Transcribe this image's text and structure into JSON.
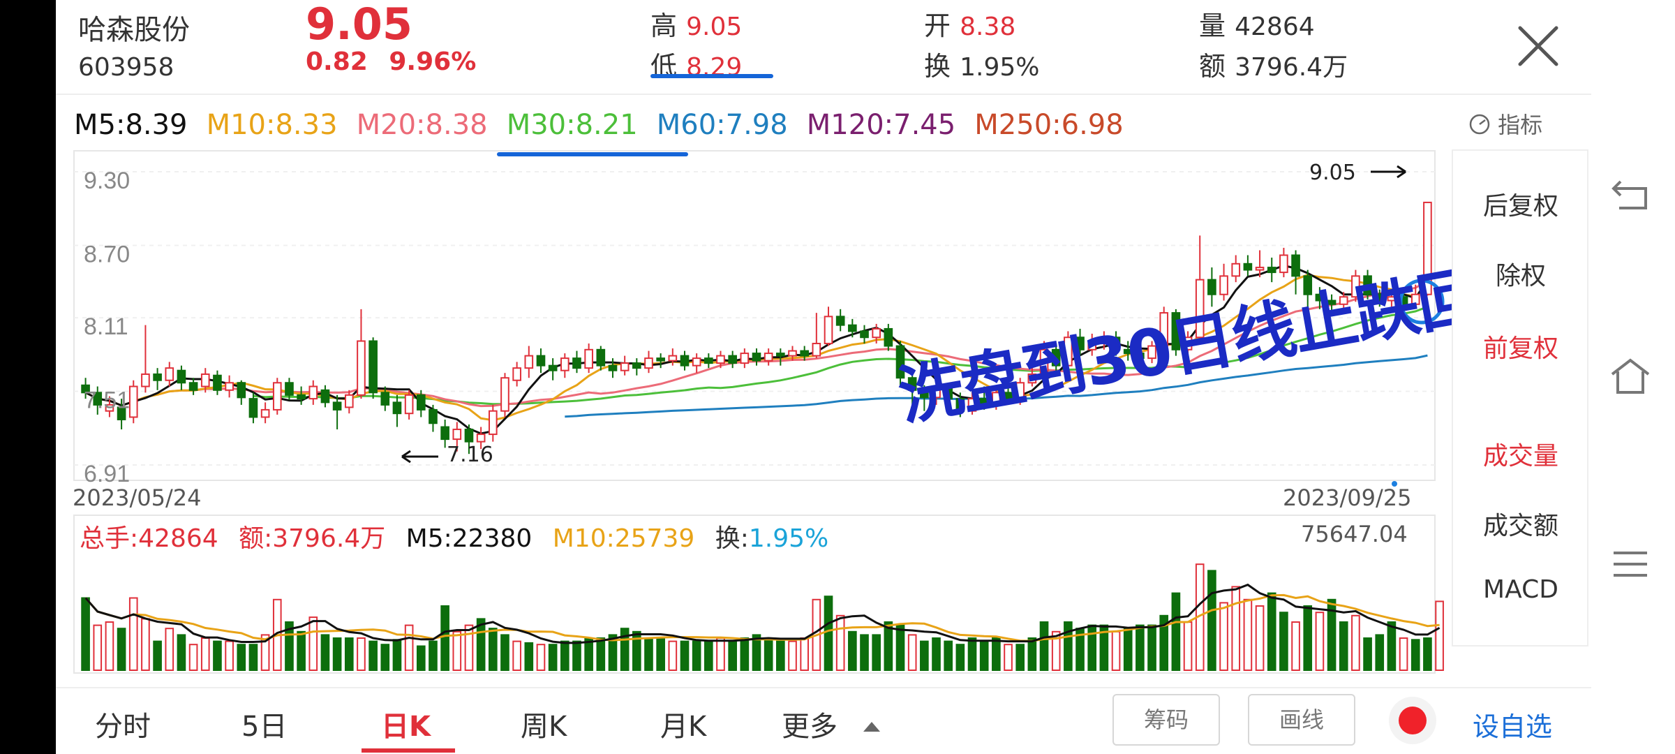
{
  "header": {
    "name": "哈森股份",
    "code": "603958",
    "price": "9.05",
    "change": "0.82",
    "change_pct": "9.96%",
    "high_label": "高",
    "high": "9.05",
    "low_label": "低",
    "low": "8.29",
    "open_label": "开",
    "open": "8.38",
    "turnover_label": "换",
    "turnover": "1.95%",
    "volume_label": "量",
    "volume": "42864",
    "amount_label": "额",
    "amount": "3796.4万"
  },
  "ma": {
    "m5": "M5:8.39",
    "m10": "M10:8.33",
    "m20": "M20:8.38",
    "m30": "M30:8.21",
    "m60": "M60:7.98",
    "m120": "M120:7.45",
    "m250": "M250:6.98"
  },
  "indicator_label": "指标",
  "chart": {
    "price_ticks": [
      "9.30",
      "8.70",
      "8.11",
      "7.51",
      "6.91"
    ],
    "price_ticks_num": [
      9.3,
      8.7,
      8.11,
      7.51,
      6.91
    ],
    "date_start": "2023/05/24",
    "date_end": "2023/09/25",
    "low_annotation": "7.16",
    "high_annotation": "9.05",
    "note": "洗盘到30日线止跌回升",
    "colors": {
      "up": "#e0303a",
      "down": "#0d6e0d",
      "m5": "#111111",
      "m10": "#e8a317",
      "m20": "#ec6b78",
      "m30": "#4cbf3a",
      "m60": "#1f7fbf"
    }
  },
  "volume": {
    "total_label": "总手:42864",
    "amount_label": "额:3796.4万",
    "m5": "M5:22380",
    "m10": "M10:25739",
    "turnover_prefix": "换:",
    "turnover_value": "1.95%",
    "max": "75647.04"
  },
  "sidebar": [
    "后复权",
    "除权",
    "前复权",
    "成交量",
    "成交额",
    "MACD"
  ],
  "tabs": [
    "分时",
    "5日",
    "日K",
    "周K",
    "月K",
    "更多"
  ],
  "buttons": {
    "chips": "筹码",
    "draw": "画线",
    "watchlist": "设自选"
  },
  "chart_data": {
    "type": "candlestick",
    "title": "",
    "x": [
      "2023/05/24",
      "2023/09/25"
    ],
    "ylim": [
      6.91,
      9.3
    ],
    "y_ticks": [
      9.3,
      8.7,
      8.11,
      7.51,
      6.91
    ],
    "candles": [
      [
        7.56,
        7.5,
        7.62,
        7.45
      ],
      [
        7.5,
        7.4,
        7.55,
        7.32
      ],
      [
        7.35,
        7.4,
        7.47,
        7.3
      ],
      [
        7.38,
        7.28,
        7.45,
        7.2
      ],
      [
        7.3,
        7.55,
        7.6,
        7.25
      ],
      [
        7.55,
        7.65,
        8.05,
        7.5
      ],
      [
        7.65,
        7.6,
        7.7,
        7.52
      ],
      [
        7.6,
        7.7,
        7.75,
        7.55
      ],
      [
        7.68,
        7.58,
        7.72,
        7.52
      ],
      [
        7.58,
        7.52,
        7.62,
        7.48
      ],
      [
        7.55,
        7.65,
        7.7,
        7.5
      ],
      [
        7.64,
        7.52,
        7.68,
        7.48
      ],
      [
        7.52,
        7.58,
        7.64,
        7.46
      ],
      [
        7.58,
        7.46,
        7.6,
        7.4
      ],
      [
        7.45,
        7.3,
        7.5,
        7.25
      ],
      [
        7.3,
        7.36,
        7.42,
        7.25
      ],
      [
        7.36,
        7.58,
        7.62,
        7.32
      ],
      [
        7.58,
        7.48,
        7.62,
        7.44
      ],
      [
        7.48,
        7.45,
        7.55,
        7.4
      ],
      [
        7.45,
        7.55,
        7.6,
        7.4
      ],
      [
        7.52,
        7.42,
        7.56,
        7.38
      ],
      [
        7.42,
        7.36,
        7.48,
        7.2
      ],
      [
        7.38,
        7.48,
        7.52,
        7.33
      ],
      [
        7.48,
        7.92,
        8.18,
        7.45
      ],
      [
        7.92,
        7.5,
        7.95,
        7.45
      ],
      [
        7.5,
        7.4,
        7.55,
        7.35
      ],
      [
        7.42,
        7.33,
        7.48,
        7.22
      ],
      [
        7.33,
        7.48,
        7.52,
        7.28
      ],
      [
        7.48,
        7.36,
        7.52,
        7.3
      ],
      [
        7.36,
        7.25,
        7.4,
        7.18
      ],
      [
        7.22,
        7.12,
        7.28,
        7.05
      ],
      [
        7.12,
        7.2,
        7.26,
        7.02
      ],
      [
        7.2,
        7.1,
        7.24,
        7.0
      ],
      [
        7.1,
        7.16,
        7.22,
        7.04
      ],
      [
        7.16,
        7.35,
        7.4,
        7.1
      ],
      [
        7.35,
        7.62,
        7.66,
        7.3
      ],
      [
        7.6,
        7.7,
        7.75,
        7.55
      ],
      [
        7.7,
        7.8,
        7.88,
        7.62
      ],
      [
        7.8,
        7.72,
        7.86,
        7.66
      ],
      [
        7.72,
        7.68,
        7.78,
        7.6
      ],
      [
        7.68,
        7.78,
        7.82,
        7.62
      ],
      [
        7.78,
        7.7,
        7.84,
        7.66
      ],
      [
        7.7,
        7.85,
        7.9,
        7.66
      ],
      [
        7.85,
        7.72,
        7.88,
        7.68
      ],
      [
        7.72,
        7.68,
        7.78,
        7.62
      ],
      [
        7.68,
        7.74,
        7.8,
        7.64
      ],
      [
        7.74,
        7.7,
        7.78,
        7.64
      ],
      [
        7.7,
        7.78,
        7.84,
        7.66
      ],
      [
        7.78,
        7.76,
        7.82,
        7.7
      ],
      [
        7.76,
        7.8,
        7.86,
        7.72
      ],
      [
        7.8,
        7.72,
        7.84,
        7.68
      ],
      [
        7.72,
        7.78,
        7.82,
        7.66
      ],
      [
        7.78,
        7.74,
        7.82,
        7.7
      ],
      [
        7.74,
        7.8,
        7.84,
        7.7
      ],
      [
        7.8,
        7.74,
        7.84,
        7.7
      ],
      [
        7.74,
        7.82,
        7.86,
        7.7
      ],
      [
        7.82,
        7.76,
        7.86,
        7.72
      ],
      [
        7.76,
        7.82,
        7.86,
        7.72
      ],
      [
        7.82,
        7.8,
        7.86,
        7.72
      ],
      [
        7.8,
        7.84,
        7.88,
        7.76
      ],
      [
        7.84,
        7.8,
        7.88,
        7.76
      ],
      [
        7.8,
        7.9,
        8.15,
        7.78
      ],
      [
        7.9,
        8.12,
        8.2,
        7.88
      ],
      [
        8.12,
        8.05,
        8.18,
        8.0
      ],
      [
        8.05,
        8.0,
        8.1,
        7.95
      ],
      [
        8.0,
        7.95,
        8.05,
        7.9
      ],
      [
        7.95,
        8.02,
        8.06,
        7.9
      ],
      [
        8.02,
        7.88,
        8.06,
        7.84
      ],
      [
        7.88,
        7.62,
        7.92,
        7.55
      ],
      [
        7.62,
        7.52,
        7.66,
        7.4
      ],
      [
        7.52,
        7.46,
        7.56,
        7.35
      ],
      [
        7.46,
        7.55,
        7.6,
        7.4
      ],
      [
        7.55,
        7.45,
        7.58,
        7.38
      ],
      [
        7.45,
        7.35,
        7.5,
        7.3
      ],
      [
        7.35,
        7.45,
        7.52,
        7.32
      ],
      [
        7.45,
        7.4,
        7.55,
        7.36
      ],
      [
        7.4,
        7.5,
        7.56,
        7.36
      ],
      [
        7.5,
        7.45,
        7.58,
        7.4
      ],
      [
        7.45,
        7.58,
        7.62,
        7.4
      ],
      [
        7.58,
        7.65,
        7.75,
        7.55
      ],
      [
        7.65,
        7.85,
        7.92,
        7.6
      ],
      [
        7.85,
        7.72,
        7.9,
        7.68
      ],
      [
        7.72,
        7.95,
        8.0,
        7.7
      ],
      [
        7.95,
        7.85,
        8.02,
        7.8
      ],
      [
        7.85,
        7.9,
        7.98,
        7.8
      ],
      [
        7.9,
        7.95,
        8.0,
        7.85
      ],
      [
        7.95,
        7.85,
        8.0,
        7.8
      ],
      [
        7.85,
        7.82,
        7.92,
        7.76
      ],
      [
        7.82,
        7.78,
        7.88,
        7.74
      ],
      [
        7.78,
        7.88,
        7.92,
        7.74
      ],
      [
        7.88,
        8.15,
        8.2,
        7.85
      ],
      [
        8.15,
        7.85,
        8.18,
        7.8
      ],
      [
        7.85,
        7.95,
        8.0,
        7.82
      ],
      [
        7.95,
        8.42,
        8.78,
        7.92
      ],
      [
        8.42,
        8.3,
        8.52,
        8.2
      ],
      [
        8.3,
        8.45,
        8.55,
        8.25
      ],
      [
        8.45,
        8.55,
        8.62,
        8.4
      ],
      [
        8.55,
        8.5,
        8.62,
        8.45
      ],
      [
        8.5,
        8.52,
        8.66,
        8.44
      ],
      [
        8.52,
        8.48,
        8.6,
        8.4
      ],
      [
        8.48,
        8.62,
        8.68,
        8.44
      ],
      [
        8.62,
        8.45,
        8.66,
        8.3
      ],
      [
        8.45,
        8.3,
        8.5,
        8.2
      ],
      [
        8.3,
        8.25,
        8.36,
        8.18
      ],
      [
        8.25,
        8.22,
        8.3,
        8.15
      ],
      [
        8.22,
        8.28,
        8.32,
        8.16
      ],
      [
        8.28,
        8.45,
        8.5,
        8.24
      ],
      [
        8.45,
        8.3,
        8.5,
        8.26
      ],
      [
        8.3,
        8.25,
        8.34,
        8.2
      ],
      [
        8.25,
        8.28,
        8.32,
        8.2
      ],
      [
        8.28,
        8.22,
        8.32,
        8.18
      ],
      [
        8.22,
        8.3,
        8.38,
        8.2
      ],
      [
        8.3,
        9.05,
        9.05,
        8.29
      ]
    ],
    "volume_max": 75647.04,
    "volume_bars": [
      [
        45000,
        0
      ],
      [
        28000,
        1
      ],
      [
        30000,
        1
      ],
      [
        26000,
        0
      ],
      [
        45000,
        1
      ],
      [
        32000,
        1
      ],
      [
        18000,
        0
      ],
      [
        26000,
        1
      ],
      [
        22000,
        0
      ],
      [
        16000,
        1
      ],
      [
        20000,
        1
      ],
      [
        18000,
        0
      ],
      [
        18000,
        1
      ],
      [
        16000,
        0
      ],
      [
        16000,
        0
      ],
      [
        22000,
        1
      ],
      [
        44000,
        1
      ],
      [
        30000,
        0
      ],
      [
        24000,
        0
      ],
      [
        33000,
        1
      ],
      [
        22000,
        0
      ],
      [
        20000,
        0
      ],
      [
        20000,
        0
      ],
      [
        20000,
        1
      ],
      [
        18000,
        0
      ],
      [
        16000,
        0
      ],
      [
        19000,
        0
      ],
      [
        28000,
        1
      ],
      [
        15000,
        0
      ],
      [
        18000,
        0
      ],
      [
        40000,
        0
      ],
      [
        24000,
        1
      ],
      [
        28000,
        1
      ],
      [
        32000,
        0
      ],
      [
        26000,
        0
      ],
      [
        22000,
        0
      ],
      [
        18000,
        1
      ],
      [
        17000,
        0
      ],
      [
        16000,
        1
      ],
      [
        16000,
        0
      ],
      [
        18000,
        0
      ],
      [
        18000,
        0
      ],
      [
        20000,
        0
      ],
      [
        20000,
        0
      ],
      [
        22000,
        0
      ],
      [
        26000,
        0
      ],
      [
        24000,
        0
      ],
      [
        20000,
        0
      ],
      [
        20000,
        0
      ],
      [
        18000,
        1
      ],
      [
        18000,
        0
      ],
      [
        18000,
        0
      ],
      [
        18000,
        0
      ],
      [
        20000,
        1
      ],
      [
        18000,
        0
      ],
      [
        20000,
        0
      ],
      [
        22000,
        0
      ],
      [
        20000,
        0
      ],
      [
        18000,
        0
      ],
      [
        18000,
        1
      ],
      [
        20000,
        1
      ],
      [
        44000,
        1
      ],
      [
        46000,
        0
      ],
      [
        34000,
        1
      ],
      [
        24000,
        0
      ],
      [
        22000,
        0
      ],
      [
        22000,
        0
      ],
      [
        30000,
        0
      ],
      [
        28000,
        0
      ],
      [
        22000,
        1
      ],
      [
        18000,
        0
      ],
      [
        20000,
        0
      ],
      [
        18000,
        0
      ],
      [
        16000,
        0
      ],
      [
        20000,
        0
      ],
      [
        18000,
        0
      ],
      [
        20000,
        0
      ],
      [
        16000,
        1
      ],
      [
        16000,
        0
      ],
      [
        20000,
        0
      ],
      [
        30000,
        0
      ],
      [
        24000,
        1
      ],
      [
        30000,
        0
      ],
      [
        26000,
        0
      ],
      [
        28000,
        0
      ],
      [
        28000,
        0
      ],
      [
        24000,
        1
      ],
      [
        26000,
        0
      ],
      [
        28000,
        0
      ],
      [
        28000,
        0
      ],
      [
        34000,
        0
      ],
      [
        48000,
        0
      ],
      [
        30000,
        1
      ],
      [
        66000,
        1
      ],
      [
        62000,
        0
      ],
      [
        42000,
        1
      ],
      [
        52000,
        1
      ],
      [
        44000,
        1
      ],
      [
        40000,
        1
      ],
      [
        48000,
        0
      ],
      [
        36000,
        0
      ],
      [
        30000,
        1
      ],
      [
        40000,
        0
      ],
      [
        36000,
        1
      ],
      [
        44000,
        0
      ],
      [
        30000,
        0
      ],
      [
        34000,
        1
      ],
      [
        20000,
        0
      ],
      [
        22000,
        0
      ],
      [
        30000,
        0
      ],
      [
        20000,
        1
      ],
      [
        19000,
        0
      ],
      [
        20000,
        0
      ],
      [
        42864,
        1
      ]
    ]
  }
}
